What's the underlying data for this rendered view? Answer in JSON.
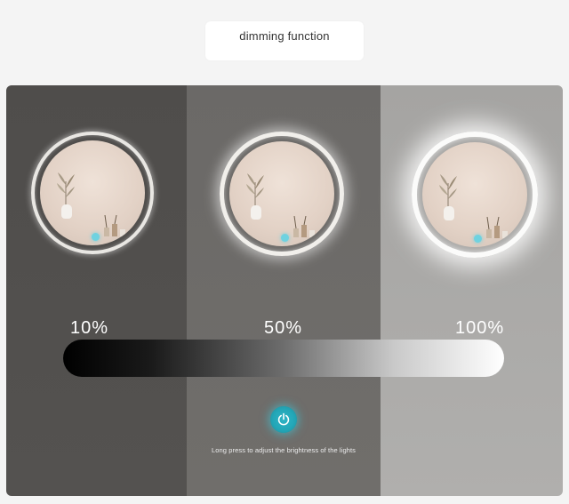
{
  "title": "dimming function",
  "levels": [
    {
      "label": "10%",
      "brightness": 0.1
    },
    {
      "label": "50%",
      "brightness": 0.5
    },
    {
      "label": "100%",
      "brightness": 1.0
    }
  ],
  "hint": "Long press to adjust the brightness of the lights",
  "icons": {
    "power": "power-icon",
    "mirror": "round-led-mirror"
  },
  "colors": {
    "accent": "#2fb3c4",
    "panel_10": "#514f4d",
    "panel_50": "#6d6b69",
    "panel_100": "#aaa9a7"
  }
}
